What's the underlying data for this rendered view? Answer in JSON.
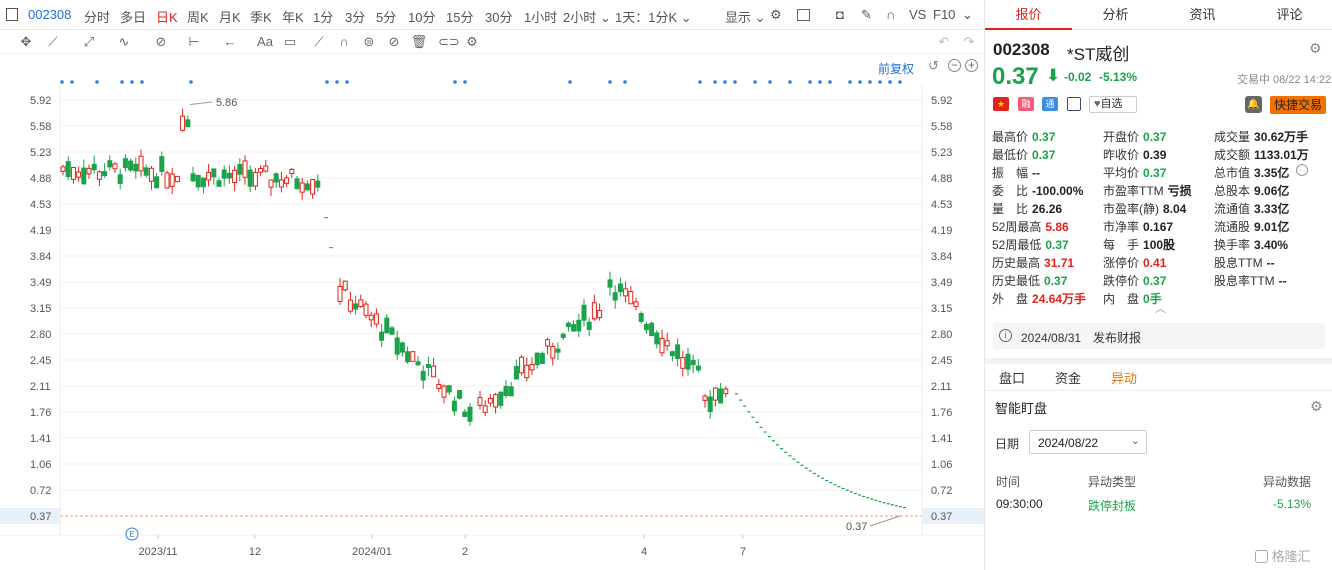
{
  "toolbar": {
    "code": "002308",
    "periods": [
      "分时",
      "多日",
      "日K",
      "周K",
      "月K",
      "季K",
      "年K",
      "1分",
      "3分",
      "5分",
      "10分",
      "15分",
      "30分",
      "1小时",
      "2小时",
      "1天：1分K"
    ],
    "active_period": "日K",
    "display_label": "显示",
    "vs_label": "VS",
    "f10_label": "F10",
    "restore_label": "前复权"
  },
  "chart_data": {
    "type": "candlestick",
    "title": "",
    "y_ticks": [
      "5.92",
      "5.58",
      "5.23",
      "4.88",
      "4.53",
      "4.19",
      "3.84",
      "3.49",
      "3.15",
      "2.80",
      "2.45",
      "2.11",
      "1.76",
      "1.41",
      "1.06",
      "0.72",
      "0.37"
    ],
    "ylim": [
      0.37,
      5.92
    ],
    "x_ticks": [
      "2023/11",
      "12",
      "2024/01",
      "2",
      "4",
      "7"
    ],
    "annotations": {
      "high_label": "5.86",
      "low_label": "0.37",
      "current_price_tag": "0.37",
      "event_marker": "E"
    },
    "series_trend": [
      {
        "segment": "2023/10-2023/12",
        "range": [
          4.8,
          5.86
        ]
      },
      {
        "segment": "2023/12-2024/01",
        "range": [
          3.2,
          4.88
        ]
      },
      {
        "segment": "2024/01-2024/02",
        "range": [
          1.65,
          3.5
        ]
      },
      {
        "segment": "2024/02-2024/03",
        "range": [
          2.5,
          3.95
        ]
      },
      {
        "segment": "2024/04-2024/05",
        "range": [
          1.76,
          3.1
        ]
      },
      {
        "segment": "2024/05-2024/08",
        "range": [
          0.37,
          2.2
        ]
      }
    ],
    "up_color": "#e2231a",
    "down_color": "#1aa34a",
    "grid": "horizontal"
  },
  "quote": {
    "code": "002308",
    "name": "*ST威创",
    "price": "0.37",
    "change": "-0.02",
    "change_pct": "-5.13%",
    "time": "交易中 08/22 14:22",
    "watch_label": "自选",
    "fast_trade_label": "快捷交易",
    "fields": [
      [
        {
          "l": "最高价",
          "v": "0.37",
          "c": "green"
        },
        {
          "l": "开盘价",
          "v": "0.37",
          "c": "green"
        },
        {
          "l": "成交量",
          "v": "30.62万手",
          "c": "blk"
        }
      ],
      [
        {
          "l": "最低价",
          "v": "0.37",
          "c": "green"
        },
        {
          "l": "昨收价",
          "v": "0.39",
          "c": "blk"
        },
        {
          "l": "成交额",
          "v": "1133.01万",
          "c": "blk"
        }
      ],
      [
        {
          "l": "振　幅",
          "v": "--",
          "c": "blk"
        },
        {
          "l": "平均价",
          "v": "0.37",
          "c": "green"
        },
        {
          "l": "总市值",
          "v": "3.35亿",
          "c": "blk"
        }
      ],
      [
        {
          "l": "委　比",
          "v": "-100.00%",
          "c": "blk"
        },
        {
          "l": "市盈率TTM",
          "v": "亏损",
          "c": "blk"
        },
        {
          "l": "总股本",
          "v": "9.06亿",
          "c": "blk"
        }
      ],
      [
        {
          "l": "量　比",
          "v": "26.26",
          "c": "blk"
        },
        {
          "l": "市盈率(静)",
          "v": "8.04",
          "c": "blk"
        },
        {
          "l": "流通值",
          "v": "3.33亿",
          "c": "blk"
        }
      ],
      [
        {
          "l": "52周最高",
          "v": "5.86",
          "c": "red"
        },
        {
          "l": "市净率",
          "v": "0.167",
          "c": "blk"
        },
        {
          "l": "流通股",
          "v": "9.01亿",
          "c": "blk"
        }
      ],
      [
        {
          "l": "52周最低",
          "v": "0.37",
          "c": "green"
        },
        {
          "l": "每　手",
          "v": "100股",
          "c": "blk"
        },
        {
          "l": "换手率",
          "v": "3.40%",
          "c": "blk"
        }
      ],
      [
        {
          "l": "历史最高",
          "v": "31.71",
          "c": "red"
        },
        {
          "l": "涨停价",
          "v": "0.41",
          "c": "red"
        },
        {
          "l": "股息TTM",
          "v": "--",
          "c": "blk"
        }
      ],
      [
        {
          "l": "历史最低",
          "v": "0.37",
          "c": "green"
        },
        {
          "l": "跌停价",
          "v": "0.37",
          "c": "green"
        },
        {
          "l": "股息率TTM",
          "v": "--",
          "c": "blk"
        }
      ],
      [
        {
          "l": "外　盘",
          "v": "24.64万手",
          "c": "red"
        },
        {
          "l": "内　盘",
          "v": "0手",
          "c": "green"
        }
      ]
    ],
    "notice": "2024/08/31　发布财报"
  },
  "panel": {
    "tabs": [
      "报价",
      "分析",
      "资讯",
      "评论"
    ],
    "subtabs": [
      "盘口",
      "资金",
      "异动"
    ],
    "monitor_title": "智能盯盘",
    "date_label": "日期",
    "date_value": "2024/08/22",
    "table_headers": [
      "时间",
      "异动类型",
      "异动数据"
    ],
    "table_rows": [
      [
        "09:30:00",
        "跌停封板",
        "-5.13%"
      ]
    ],
    "watermark": "格隆汇"
  }
}
